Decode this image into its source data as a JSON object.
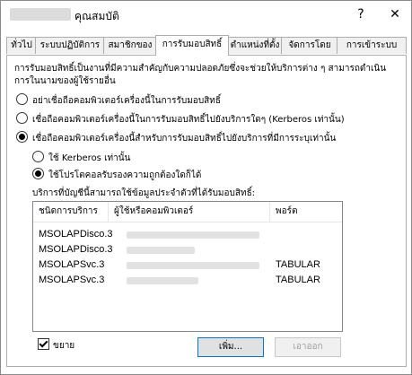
{
  "window": {
    "title": "คุณสมบัติ",
    "help_label": "?",
    "close_label": "✕"
  },
  "tabs": [
    {
      "label": "ทั่วไป"
    },
    {
      "label": "ระบบปฏิบัติการ"
    },
    {
      "label": "สมาชิกของ"
    },
    {
      "label": "การรับมอบสิทธิ์"
    },
    {
      "label": "ตำแหน่งที่ตั้ง"
    },
    {
      "label": "จัดการโดย"
    },
    {
      "label": "การเข้าระบบ"
    }
  ],
  "delegation": {
    "description": "การรับมอบสิทธิ์เป็นงานที่มีความสำคัญกับความปลอดภัยซึ่งจะช่วยให้บริการต่าง ๆ สามารถดำเนินการในนามของผู้ใช้รายอื่น",
    "options": [
      {
        "label": "อย่าเชื่อถือคอมพิวเตอร์เครื่องนี้ในการรับมอบสิทธิ์",
        "selected": false
      },
      {
        "label": "เชื่อถือคอมพิวเตอร์เครื่องนี้ในการรับมอบสิทธิ์ไปยังบริการใดๆ (Kerberos เท่านั้น)",
        "selected": false
      },
      {
        "label": "เชื่อถือคอมพิวเตอร์เครื่องนี้สำหรับการรับมอบสิทธิ์ไปยังบริการที่มีการระบุเท่านั้น",
        "selected": true
      }
    ],
    "sub_options": [
      {
        "label": "ใช้ Kerberos เท่านั้น",
        "selected": false
      },
      {
        "label": "ใช้โปรโตคอลรับรองความถูกต้องใดก็ได้",
        "selected": true
      }
    ],
    "list_label": "บริการที่บัญชีนี้สามารถใช้ข้อมูลประจำตัวที่ได้รับมอบสิทธิ์:",
    "columns": [
      "ชนิดการบริการ",
      "ผู้ใช้หรือคอมพิวเตอร์",
      "พอร์ต"
    ],
    "rows": [
      {
        "service": "MSOLAPDisco.3",
        "port": ""
      },
      {
        "service": "MSOLAPDisco.3",
        "port": ""
      },
      {
        "service": "MSOLAPSvc.3",
        "port": "TABULAR"
      },
      {
        "service": "MSOLAPSvc.3",
        "port": "TABULAR"
      }
    ],
    "expand_label": "ขยาย",
    "expand_checked": true,
    "add_button": "เพิ่ม...",
    "remove_button": "เอาออก"
  }
}
